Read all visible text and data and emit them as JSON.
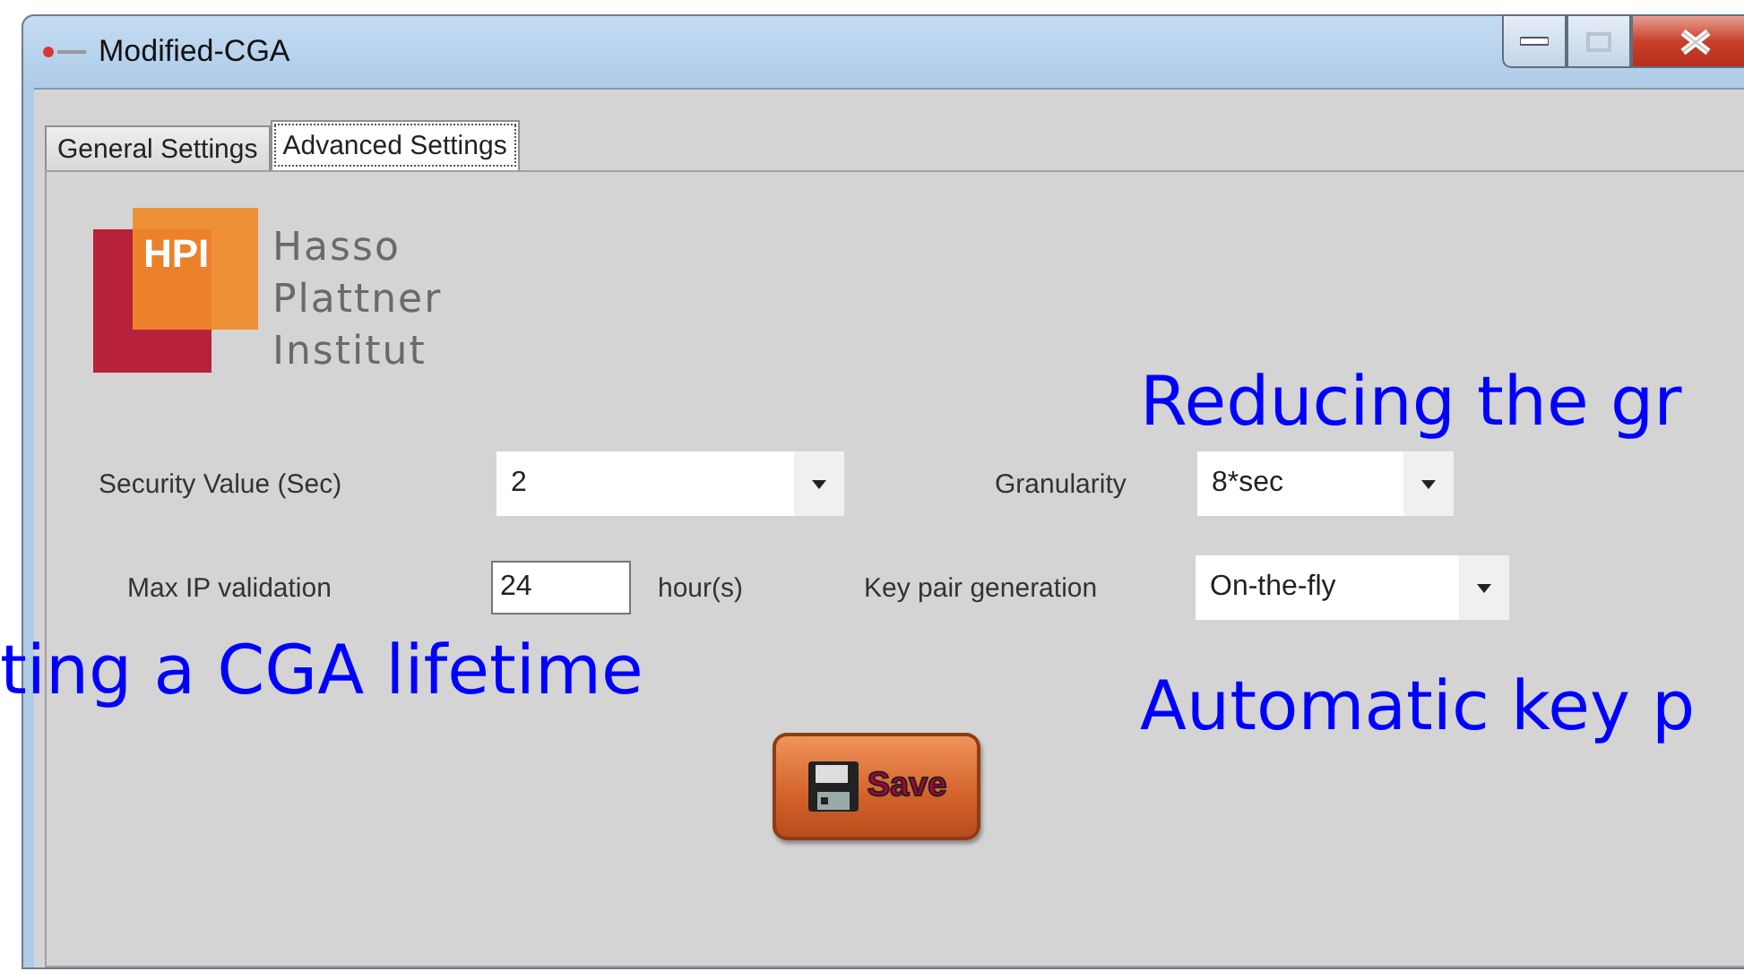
{
  "window": {
    "title": "Modified-CGA"
  },
  "tabs": [
    {
      "label": "General Settings",
      "selected": false
    },
    {
      "label": "Advanced Settings",
      "selected": true
    }
  ],
  "logo": {
    "mark": "HPI",
    "name_lines": [
      "Hasso",
      "Plattner",
      "Institut"
    ]
  },
  "fields": [
    {
      "kind": "dropdown",
      "label": "Security Value (Sec)",
      "value": "2"
    },
    {
      "kind": "dropdown",
      "label": "Granularity",
      "value": "8*sec"
    },
    {
      "kind": "text",
      "label": "Max IP validation",
      "value": "24",
      "unit": "hour(s)"
    },
    {
      "kind": "dropdown",
      "label": "Key pair generation",
      "value": "On-the-fly"
    }
  ],
  "save_button": {
    "label": "Save"
  },
  "annotations": [
    "Reducing the gr",
    "ting a CGA lifetime",
    "Automatic key p"
  ]
}
